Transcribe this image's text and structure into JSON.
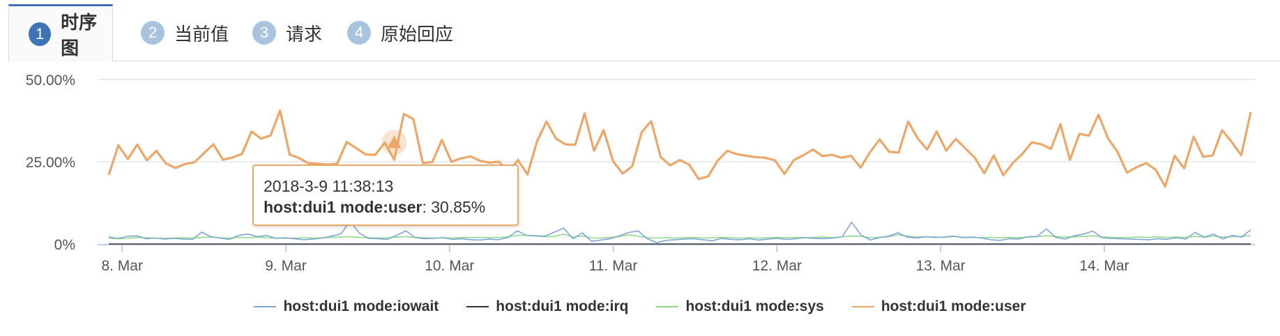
{
  "tabs": [
    {
      "num": "1",
      "label": "时序图",
      "active": true
    },
    {
      "num": "2",
      "label": "当前值",
      "active": false
    },
    {
      "num": "3",
      "label": "请求",
      "active": false
    },
    {
      "num": "4",
      "label": "原始回应",
      "active": false
    }
  ],
  "colors": {
    "iowait": "#7ca6d8",
    "irq": "#333333",
    "sys": "#90d98a",
    "user": "#eba668",
    "grid": "#e6e6e6",
    "axis": "#c0d0e0",
    "tab_accent": "#3e73b5"
  },
  "tooltip": {
    "time": "2018-3-9 11:38:13",
    "series": "host:dui1 mode:user",
    "value": ": 30.85%"
  },
  "chart_data": {
    "type": "line",
    "x_ticks": [
      "8. Mar",
      "9. Mar",
      "10. Mar",
      "11. Mar",
      "12. Mar",
      "13. Mar",
      "14. Mar"
    ],
    "y_ticks": [
      "0%",
      "25.00%",
      "50.00%"
    ],
    "ylim": [
      0,
      50
    ],
    "x_range_days": [
      7.85,
      14.92
    ],
    "grid": true,
    "legend_position": "bottom-center",
    "series": [
      {
        "name": "host:dui1 mode:iowait",
        "color": "#7ca6d8",
        "values": [
          2.1,
          1.7,
          2.3,
          2.5,
          1.6,
          1.8,
          1.5,
          1.7,
          1.5,
          1.4,
          3.6,
          2.2,
          1.8,
          1.4,
          2.6,
          3.0,
          2.2,
          2.6,
          1.7,
          1.9,
          1.6,
          1.3,
          1.5,
          1.8,
          2.4,
          3.1,
          6.8,
          3.3,
          1.7,
          1.6,
          1.4,
          2.6,
          4.0,
          2.0,
          1.6,
          1.7,
          1.9,
          1.4,
          1.6,
          1.3,
          1.2,
          1.5,
          1.3,
          2.0,
          4.0,
          2.6,
          2.5,
          2.4,
          3.6,
          4.8,
          1.6,
          3.4,
          0.8,
          1.2,
          1.6,
          2.5,
          3.5,
          4.0,
          1.6,
          0.4,
          1.1,
          1.3,
          1.5,
          1.6,
          1.3,
          1.0,
          1.7,
          1.4,
          1.3,
          1.6,
          1.2,
          1.5,
          1.7,
          1.4,
          1.6,
          1.9,
          1.7,
          1.6,
          1.8,
          2.2,
          6.6,
          2.8,
          1.2,
          1.9,
          2.4,
          3.4,
          2.1,
          1.8,
          2.2,
          2.0,
          2.1,
          2.4,
          1.9,
          2.1,
          1.8,
          1.3,
          1.1,
          1.6,
          1.5,
          2.2,
          2.3,
          4.6,
          2.0,
          1.5,
          2.5,
          3.0,
          3.9,
          1.9,
          1.7,
          1.6,
          1.5,
          1.4,
          1.3,
          1.6,
          1.4,
          1.9,
          1.5,
          3.5,
          2.1,
          3.0,
          1.5,
          2.6,
          2.1,
          4.3
        ]
      },
      {
        "name": "host:dui1 mode:irq",
        "color": "#333333",
        "values": [
          0,
          0,
          0,
          0,
          0,
          0,
          0,
          0,
          0,
          0,
          0,
          0,
          0,
          0,
          0,
          0,
          0,
          0,
          0,
          0,
          0,
          0,
          0,
          0,
          0,
          0,
          0,
          0,
          0,
          0,
          0,
          0,
          0,
          0,
          0,
          0,
          0,
          0,
          0,
          0,
          0,
          0,
          0,
          0,
          0,
          0,
          0,
          0,
          0,
          0,
          0,
          0,
          0,
          0,
          0,
          0,
          0,
          0,
          0,
          0,
          0,
          0,
          0,
          0,
          0,
          0,
          0,
          0,
          0,
          0,
          0,
          0,
          0,
          0,
          0,
          0,
          0,
          0,
          0,
          0,
          0,
          0,
          0,
          0,
          0,
          0,
          0,
          0,
          0,
          0,
          0,
          0,
          0,
          0,
          0,
          0,
          0,
          0,
          0,
          0,
          0,
          0,
          0,
          0,
          0,
          0,
          0,
          0,
          0,
          0,
          0,
          0,
          0,
          0,
          0,
          0,
          0,
          0,
          0,
          0,
          0,
          0,
          0,
          0
        ]
      },
      {
        "name": "host:dui1 mode:sys",
        "color": "#90d98a",
        "values": [
          1.8,
          1.6,
          1.7,
          2.0,
          1.9,
          1.8,
          1.7,
          1.8,
          1.9,
          1.8,
          2.0,
          2.1,
          1.9,
          1.8,
          2.0,
          1.9,
          2.1,
          1.9,
          1.8,
          1.7,
          1.8,
          1.9,
          1.8,
          1.9,
          2.0,
          2.1,
          2.2,
          2.0,
          1.9,
          1.8,
          1.9,
          2.1,
          2.2,
          2.0,
          1.9,
          1.8,
          1.9,
          1.8,
          2.0,
          1.9,
          2.0,
          1.9,
          2.0,
          2.1,
          2.6,
          2.7,
          2.4,
          2.2,
          2.3,
          3.0,
          2.1,
          2.4,
          1.9,
          1.8,
          2.0,
          2.2,
          2.8,
          2.4,
          1.9,
          1.8,
          1.9,
          1.8,
          1.9,
          2.0,
          1.8,
          1.9,
          2.0,
          1.9,
          1.8,
          1.9,
          1.8,
          1.9,
          2.0,
          1.9,
          2.0,
          1.9,
          2.0,
          2.1,
          1.9,
          2.2,
          2.4,
          2.3,
          1.9,
          2.0,
          2.2,
          2.8,
          2.4,
          2.1,
          2.2,
          2.1,
          2.0,
          2.3,
          2.1,
          2.0,
          1.9,
          2.0,
          1.9,
          2.0,
          1.9,
          2.1,
          2.2,
          2.5,
          2.3,
          2.1,
          2.2,
          2.3,
          2.5,
          2.1,
          2.0,
          1.9,
          2.0,
          2.1,
          2.0,
          2.2,
          2.0,
          2.1,
          2.0,
          2.3,
          2.1,
          2.4,
          2.1,
          2.2,
          2.3,
          2.5
        ]
      },
      {
        "name": "host:dui1 mode:user",
        "color": "#eba668",
        "values": [
          21.0,
          30.0,
          25.8,
          30.2,
          25.4,
          28.3,
          24.5,
          23.1,
          24.3,
          24.8,
          27.6,
          30.3,
          25.6,
          26.3,
          27.4,
          34.2,
          32.0,
          33.0,
          40.6,
          27.2,
          26.1,
          24.5,
          24.4,
          24.1,
          24.4,
          31.0,
          29.1,
          27.2,
          27.1,
          30.8,
          25.6,
          39.5,
          38.0,
          24.6,
          24.9,
          31.6,
          25.0,
          26.0,
          26.6,
          25.3,
          24.7,
          25.0,
          22.0,
          25.5,
          21.1,
          31.2,
          37.2,
          32.0,
          30.3,
          30.1,
          39.7,
          28.3,
          34.6,
          25.1,
          21.4,
          23.6,
          34.0,
          37.3,
          26.4,
          23.9,
          25.5,
          24.1,
          19.7,
          20.6,
          25.4,
          28.3,
          27.3,
          26.8,
          26.4,
          26.2,
          25.4,
          21.3,
          25.5,
          27.0,
          28.7,
          26.7,
          27.1,
          26.2,
          26.8,
          23.2,
          27.9,
          31.8,
          28.0,
          27.8,
          37.2,
          32.1,
          28.7,
          34.2,
          28.4,
          31.9,
          29.1,
          26.2,
          21.5,
          26.9,
          20.9,
          24.6,
          27.4,
          30.9,
          30.3,
          28.9,
          36.4,
          25.6,
          33.5,
          32.9,
          39.3,
          32.1,
          28.0,
          21.7,
          23.3,
          24.6,
          22.6,
          17.5,
          26.8,
          23.0,
          32.6,
          26.5,
          26.9,
          34.6,
          31.0,
          27.0,
          40.1
        ]
      }
    ],
    "highlight": {
      "series": "host:dui1 mode:user",
      "index": 30,
      "value": 30.85
    }
  }
}
